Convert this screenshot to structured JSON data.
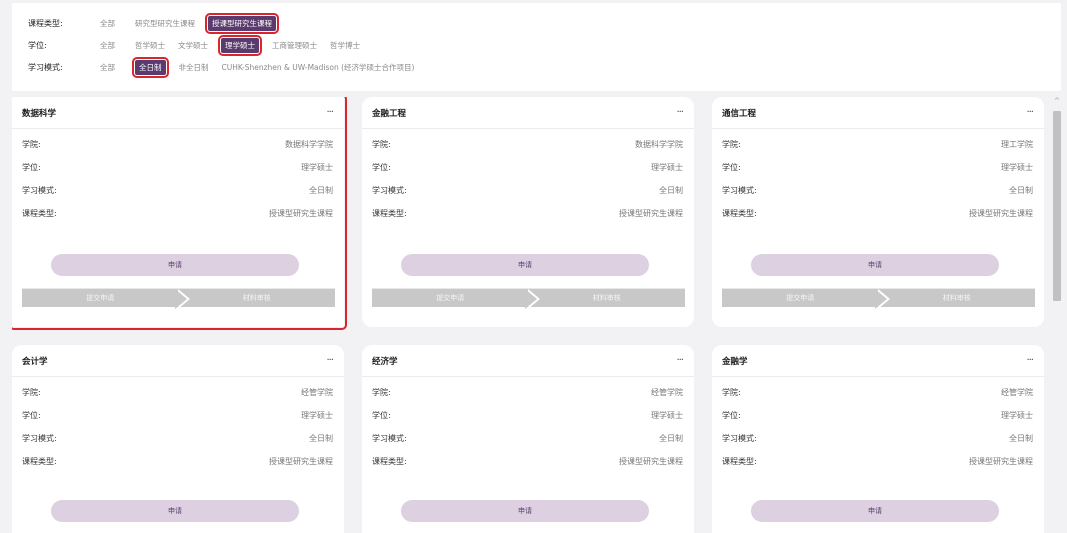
{
  "filters": {
    "course_type": {
      "label": "课程类型:",
      "options": [
        "全部",
        "研究型研究生课程",
        "授课型研究生课程"
      ],
      "selected": "授课型研究生课程"
    },
    "degree": {
      "label": "学位:",
      "options": [
        "全部",
        "哲学硕士",
        "文学硕士",
        "理学硕士",
        "工商管理硕士",
        "哲学博士"
      ],
      "selected": "理学硕士"
    },
    "study_mode": {
      "label": "学习模式:",
      "options": [
        "全部",
        "全日制",
        "非全日制",
        "CUHK-Shenzhen & UW-Madison (经济学硕士合作项目)"
      ],
      "selected": "全日制"
    }
  },
  "labels": {
    "school": "学院:",
    "degree": "学位:",
    "mode": "学习模式:",
    "type": "课程类型:",
    "apply": "申请",
    "step1": "提交申请",
    "step2": "材料审核",
    "more": "···"
  },
  "programs": [
    {
      "title": "数据科学",
      "school": "数据科学学院",
      "degree": "理学硕士",
      "mode": "全日制",
      "type": "授课型研究生课程"
    },
    {
      "title": "金融工程",
      "school": "数据科学学院",
      "degree": "理学硕士",
      "mode": "全日制",
      "type": "授课型研究生课程"
    },
    {
      "title": "通信工程",
      "school": "理工学院",
      "degree": "理学硕士",
      "mode": "全日制",
      "type": "授课型研究生课程"
    },
    {
      "title": "会计学",
      "school": "经管学院",
      "degree": "理学硕士",
      "mode": "全日制",
      "type": "授课型研究生课程"
    },
    {
      "title": "经济学",
      "school": "经管学院",
      "degree": "理学硕士",
      "mode": "全日制",
      "type": "授课型研究生课程"
    },
    {
      "title": "金融学",
      "school": "经管学院",
      "degree": "理学硕士",
      "mode": "全日制",
      "type": "授课型研究生课程"
    }
  ]
}
